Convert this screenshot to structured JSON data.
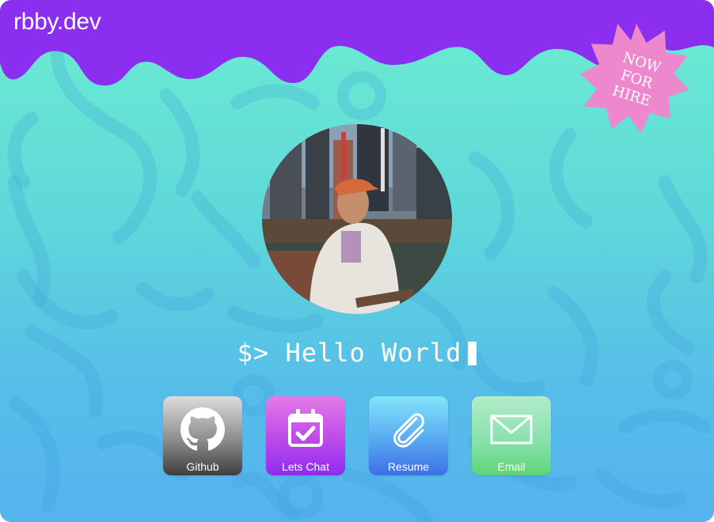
{
  "site": {
    "title": "rbby.dev"
  },
  "badge": {
    "lines": [
      "NOW",
      "FOR",
      "HIRE"
    ],
    "color": "#ee88cc"
  },
  "hero": {
    "prompt": "$> Hello World"
  },
  "links": [
    {
      "label": "Github",
      "icon": "github-icon"
    },
    {
      "label": "Lets Chat",
      "icon": "calendar-check-icon"
    },
    {
      "label": "Resume",
      "icon": "paperclip-icon"
    },
    {
      "label": "Email",
      "icon": "envelope-icon"
    }
  ],
  "colors": {
    "header": "#8b2ef0",
    "bg_top": "#6cedd0",
    "bg_bottom": "#55b3ee"
  }
}
